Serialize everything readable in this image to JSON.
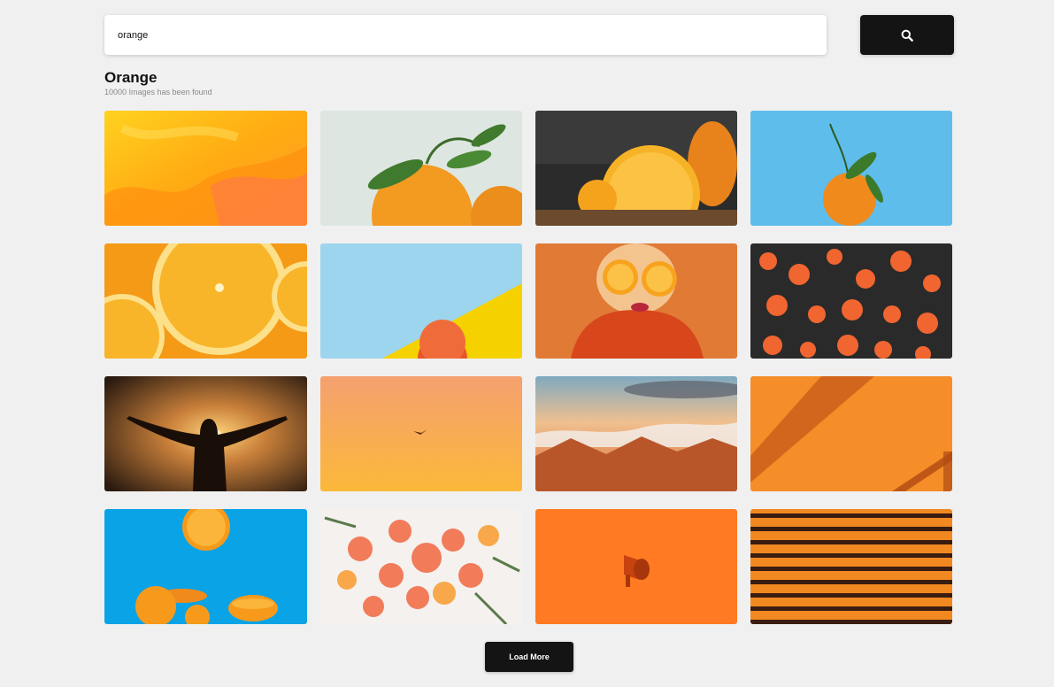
{
  "search": {
    "value": "orange",
    "button_icon": "search-icon"
  },
  "results": {
    "title": "Orange",
    "count_text": "10000 Images has been found"
  },
  "photos": [
    {
      "subject": "orange-yellow-paint-swirl",
      "colors": [
        "#ffb000",
        "#ff8a3d"
      ]
    },
    {
      "subject": "two-oranges-with-leaves",
      "colors": [
        "#dfe6e2",
        "#f39a20"
      ]
    },
    {
      "subject": "halved-orange-dark-background",
      "colors": [
        "#2b2b2b",
        "#f5a21d"
      ]
    },
    {
      "subject": "tangerine-on-blue",
      "colors": [
        "#5fbdec",
        "#f08a1c"
      ]
    },
    {
      "subject": "orange-slices-closeup",
      "colors": [
        "#f6a21b",
        "#fcd56a"
      ]
    },
    {
      "subject": "grapefruit-on-blue-yellow",
      "colors": [
        "#9dd5ef",
        "#f5d100"
      ]
    },
    {
      "subject": "woman-holding-orange-halves",
      "colors": [
        "#e07a35",
        "#d84b20"
      ]
    },
    {
      "subject": "orange-flowers-dark",
      "colors": [
        "#2a2a2a",
        "#f06530"
      ]
    },
    {
      "subject": "man-silhouette-sunset",
      "colors": [
        "#2a1a10",
        "#f3a24a"
      ]
    },
    {
      "subject": "bird-orange-sky",
      "colors": [
        "#f5a36a",
        "#fbb540"
      ]
    },
    {
      "subject": "mountains-sunset-clouds",
      "colors": [
        "#8fb2c4",
        "#d96b2a"
      ]
    },
    {
      "subject": "orange-wall-shadow",
      "colors": [
        "#f58d28",
        "#c65a18"
      ]
    },
    {
      "subject": "oranges-falling-blue",
      "colors": [
        "#0aa3e6",
        "#f79a1c"
      ]
    },
    {
      "subject": "citrus-slices-rosemary",
      "colors": [
        "#f4f1ee",
        "#f27b5a"
      ]
    },
    {
      "subject": "megaphone-on-orange",
      "colors": [
        "#ff7a22",
        "#c7420f"
      ]
    },
    {
      "subject": "orange-stripes-shadow",
      "colors": [
        "#f28820",
        "#3a1d10"
      ]
    }
  ],
  "load_more": {
    "label": "Load More"
  }
}
